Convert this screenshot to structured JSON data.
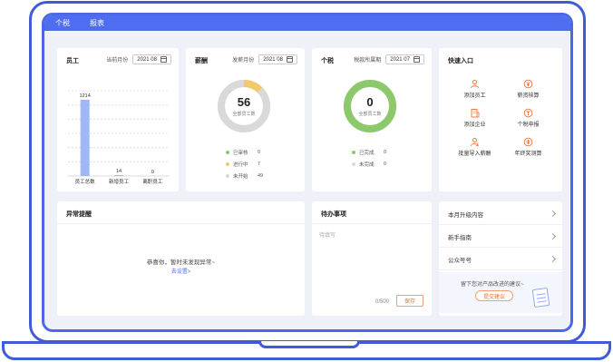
{
  "topbar": {
    "tabs": [
      "个税",
      "报表"
    ]
  },
  "employees": {
    "title": "员工",
    "month_label": "当前月份",
    "month_value": "2021 08",
    "chart_data": {
      "type": "bar",
      "categories": [
        "员工总数",
        "新增员工",
        "离职员工"
      ],
      "values": [
        1214,
        14,
        0
      ],
      "value_labels": [
        "1214",
        "14",
        "0"
      ],
      "color": "#9fb8f5",
      "grid": true
    }
  },
  "salary": {
    "title": "薪酬",
    "month_label": "发薪月份",
    "month_value": "2021 08",
    "center_value": "56",
    "center_sub": "全部员工数",
    "legend": [
      {
        "name": "已审核",
        "value": "0",
        "color": "#8cc96b"
      },
      {
        "name": "进行中",
        "value": "7",
        "color": "#f2c96c"
      },
      {
        "name": "未开始",
        "value": "49",
        "color": "#d9d9d9"
      }
    ]
  },
  "tax": {
    "title": "个税",
    "month_label": "税款所属期",
    "month_value": "2021 07",
    "center_value": "0",
    "center_sub": "全部员工数",
    "legend": [
      {
        "name": "已完成",
        "value": "0",
        "color": "#8cc96b"
      },
      {
        "name": "未完成",
        "value": "0",
        "color": "#d9d9d9"
      }
    ]
  },
  "shortcuts": {
    "title": "快速入口",
    "items": [
      {
        "label": "添加员工",
        "icon": "user-icon"
      },
      {
        "label": "薪资核算",
        "icon": "money-icon"
      },
      {
        "label": "添加企业",
        "icon": "building-icon"
      },
      {
        "label": "个税申报",
        "icon": "tax-icon"
      },
      {
        "label": "批量导入薪酬",
        "icon": "import-icon"
      },
      {
        "label": "年终奖测算",
        "icon": "calculator-icon"
      }
    ]
  },
  "exceptions": {
    "title": "异常提醒",
    "empty_text": "恭喜你，暂时未发现异常~",
    "empty_link": "去设置>"
  },
  "todo": {
    "title": "待办事项",
    "placeholder": "待填写",
    "count": "0/500",
    "save_label": "保存"
  },
  "links": {
    "items": [
      "本月升级内容",
      "新手指南",
      "公众号号"
    ],
    "feedback_text": "留下您对产品改进的建议~",
    "feedback_button": "提交建议"
  },
  "colors": {
    "accent": "#4f6df0",
    "frame": "#3f5bd8",
    "orange": "#e8733a"
  }
}
